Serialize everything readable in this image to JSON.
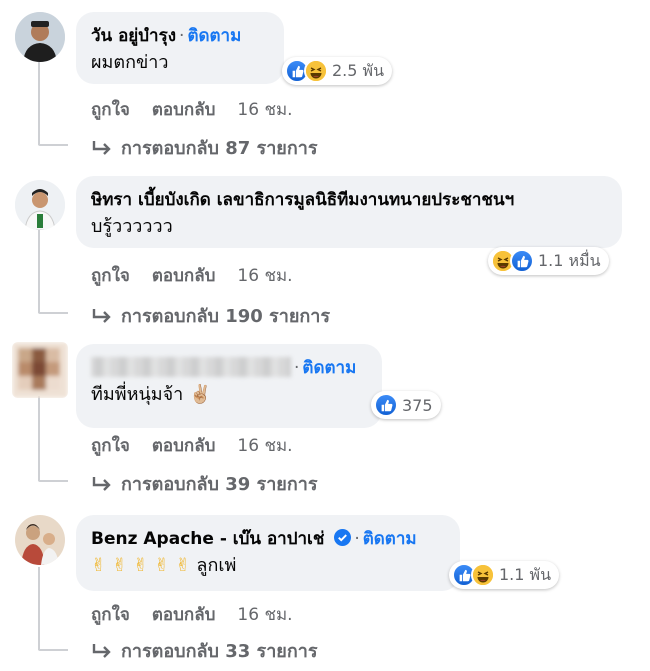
{
  "comments": [
    {
      "author": "วัน อยู่บำรุง",
      "follow": "ติดตาม",
      "text": "ผมตกข่าว",
      "reactions": "2.5 พัน",
      "reaction_icons": [
        "like-icon",
        "haha-icon"
      ],
      "like_label": "ถูกใจ",
      "reply_label": "ตอบกลับ",
      "time": "16 ชม.",
      "view_replies": "การตอบกลับ 87 รายการ"
    },
    {
      "author": "ษิทรา เบี้ยบังเกิด เลขาธิการมูลนิธิทีมงานทนายประชาชนฯ",
      "text": "บรู้วววววว",
      "reactions": "1.1 หมื่น",
      "reaction_icons": [
        "haha-icon",
        "like-icon"
      ],
      "like_label": "ถูกใจ",
      "reply_label": "ตอบกลับ",
      "time": "16 ชม.",
      "view_replies": "การตอบกลับ 190 รายการ"
    },
    {
      "author": "",
      "follow": "ติดตาม",
      "text": "ทีมพี่หนุ่มจ้า",
      "emoji": "✌🏼",
      "reactions": "375",
      "reaction_icons": [
        "like-icon"
      ],
      "like_label": "ถูกใจ",
      "reply_label": "ตอบกลับ",
      "time": "16 ชม.",
      "view_replies": "การตอบกลับ 39 รายการ"
    },
    {
      "author": "Benz Apache - เบ๊น อาปาเช่",
      "follow": "ติดตาม",
      "text": "ลูกเพ่",
      "emoji": "✌✌✌✌✌",
      "reactions": "1.1 พัน",
      "reaction_icons": [
        "like-icon",
        "haha-icon"
      ],
      "like_label": "ถูกใจ",
      "reply_label": "ตอบกลับ",
      "time": "16 ชม.",
      "view_replies": "การตอบกลับ 33 รายการ"
    }
  ],
  "colors": {
    "link": "#1877f2",
    "meta": "#65676b",
    "bubble": "#f0f2f5"
  }
}
